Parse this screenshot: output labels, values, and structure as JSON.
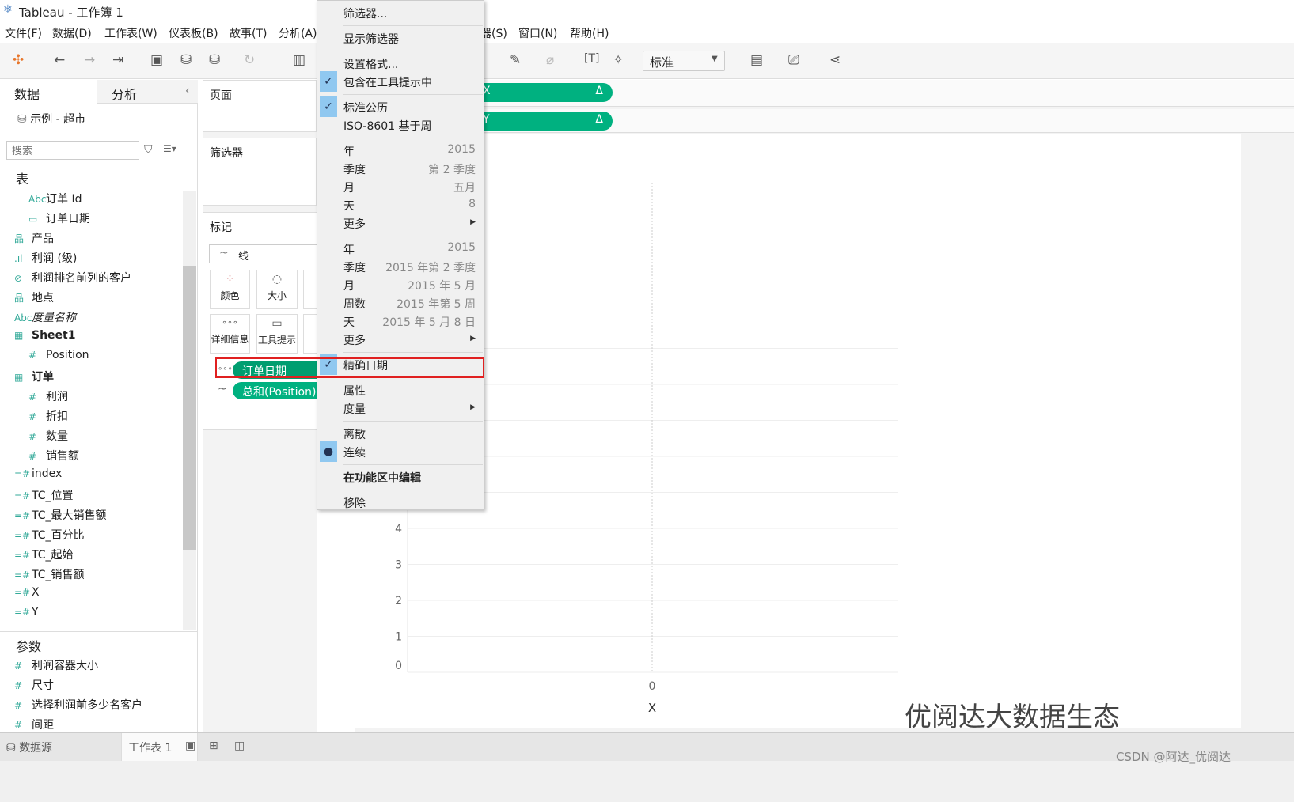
{
  "window": {
    "title": "Tableau - 工作簿 1"
  },
  "menubar": [
    "文件(F)",
    "数据(D)",
    "工作表(W)",
    "仪表板(B)",
    "故事(T)",
    "分析(A)",
    "器(S)",
    "窗口(N)",
    "帮助(H)"
  ],
  "toolbar": {
    "fit_select": "标准"
  },
  "left": {
    "tabs": [
      "数据",
      "分析"
    ],
    "datasource": "示例 - 超市",
    "search_placeholder": "搜索",
    "tables_header": "表",
    "fields": [
      {
        "icon": "Abc",
        "label": "订单 Id",
        "indent": 2
      },
      {
        "icon": "▭",
        "label": "订单日期",
        "indent": 2
      },
      {
        "icon": "品",
        "label": "产品",
        "indent": 1
      },
      {
        "icon": ".ıl",
        "label": "利润 (级)",
        "indent": 1
      },
      {
        "icon": "⊘",
        "label": "利润排名前列的客户",
        "indent": 1
      },
      {
        "icon": "品",
        "label": "地点",
        "indent": 1
      },
      {
        "icon": "Abc",
        "label": "度量名称",
        "indent": 1,
        "italic": true
      },
      {
        "icon": "▦",
        "label": "Sheet1",
        "indent": 1,
        "bold": true
      },
      {
        "icon": "#",
        "label": "Position",
        "indent": 2
      },
      {
        "icon": "▦",
        "label": "订单",
        "indent": 1,
        "bold": true
      },
      {
        "icon": "#",
        "label": "利润",
        "indent": 2
      },
      {
        "icon": "#",
        "label": "折扣",
        "indent": 2
      },
      {
        "icon": "#",
        "label": "数量",
        "indent": 2
      },
      {
        "icon": "#",
        "label": "销售额",
        "indent": 2
      },
      {
        "icon": "=#",
        "label": "index",
        "indent": 1
      },
      {
        "icon": "=#",
        "label": "TC_位置",
        "indent": 1
      },
      {
        "icon": "=#",
        "label": "TC_最大销售额",
        "indent": 1
      },
      {
        "icon": "=#",
        "label": "TC_百分比",
        "indent": 1
      },
      {
        "icon": "=#",
        "label": "TC_起始",
        "indent": 1
      },
      {
        "icon": "=#",
        "label": "TC_销售额",
        "indent": 1
      },
      {
        "icon": "=#",
        "label": "X",
        "indent": 1
      },
      {
        "icon": "=#",
        "label": "Y",
        "indent": 1
      }
    ],
    "params_header": "参数",
    "params": [
      "利润容器大小",
      "尺寸",
      "选择利润前多少名客户",
      "间距"
    ]
  },
  "shelves": {
    "pages": "页面",
    "filters": "筛选器",
    "marks": "标记",
    "mark_type": "线",
    "mark_buttons": [
      "颜色",
      "大小",
      "详细信息",
      "工具提示"
    ],
    "pills": [
      "订单日期",
      "总和(Position)"
    ]
  },
  "view": {
    "columns_pill": "X",
    "rows_pill": "Y",
    "pill_icon": "Δ"
  },
  "chart_data": {
    "type": "line",
    "xlabel": "X",
    "x_ticks": [
      "0"
    ],
    "y_ticks": [
      "0",
      "1",
      "2",
      "3",
      "4"
    ],
    "grid": true
  },
  "context_menu": {
    "items": [
      {
        "label": "筛选器..."
      },
      {
        "sep": true
      },
      {
        "label": "显示筛选器"
      },
      {
        "sep": true
      },
      {
        "label": "设置格式..."
      },
      {
        "label": "包含在工具提示中",
        "checked": true
      },
      {
        "sep": true
      },
      {
        "label": "标准公历",
        "checked": true
      },
      {
        "label": "ISO-8601 基于周"
      },
      {
        "sep": true
      },
      {
        "label": "年",
        "value": "2015"
      },
      {
        "label": "季度",
        "value": "第 2 季度"
      },
      {
        "label": "月",
        "value": "五月"
      },
      {
        "label": "天",
        "value": "8"
      },
      {
        "label": "更多",
        "submenu": true
      },
      {
        "sep": true
      },
      {
        "label": "年",
        "value": "2015"
      },
      {
        "label": "季度",
        "value": "2015 年第 2 季度"
      },
      {
        "label": "月",
        "value": "2015 年 5 月"
      },
      {
        "label": "周数",
        "value": "2015 年第 5 周"
      },
      {
        "label": "天",
        "value": "2015 年 5 月 8 日"
      },
      {
        "label": "更多",
        "submenu": true
      },
      {
        "sep": true
      },
      {
        "label": "精确日期",
        "checked": true,
        "highlighted": true
      },
      {
        "sep": true
      },
      {
        "label": "属性"
      },
      {
        "label": "度量",
        "submenu": true
      },
      {
        "sep": true
      },
      {
        "label": "离散"
      },
      {
        "label": "连续",
        "radio": true
      },
      {
        "sep": true
      },
      {
        "label": "在功能区中编辑",
        "bold": true
      },
      {
        "sep": true
      },
      {
        "label": "移除"
      }
    ]
  },
  "bottom": {
    "datasource_tab": "数据源",
    "sheet_tab": "工作表 1"
  },
  "watermark": "优阅达大数据生态",
  "credit": "CSDN @阿达_优阅达"
}
